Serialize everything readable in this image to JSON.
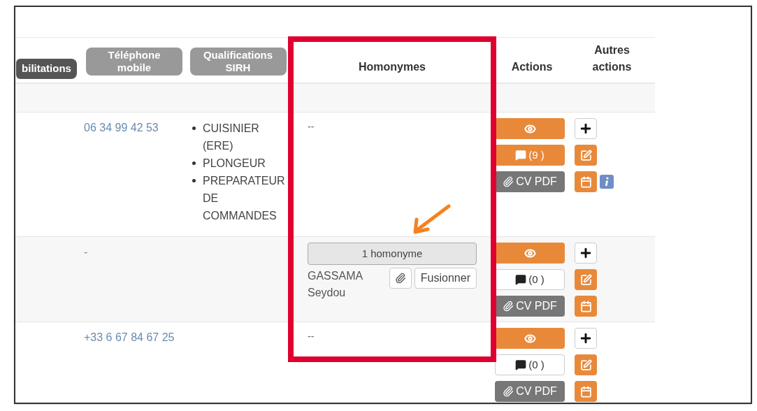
{
  "table": {
    "columns": [
      {
        "label": "bilitations",
        "kind": "pill-dark"
      },
      {
        "label": "Téléphone mobile",
        "kind": "pill"
      },
      {
        "label": "Qualifications SIRH",
        "kind": "pill"
      },
      {
        "label": "Homonymes",
        "kind": "plain"
      },
      {
        "label": "Actions",
        "kind": "plain"
      },
      {
        "label": "Autres actions",
        "kind": "plain"
      }
    ],
    "rows": [
      {
        "phone": "06 34 99 42 53",
        "qualifications": [
          "CUISINIER (ERE)",
          "PLONGEUR",
          "PREPARATEUR DE COMMANDES"
        ],
        "homonymes": {
          "text": "--"
        },
        "comments": {
          "label": "(9 )",
          "highlighted": true
        },
        "cv_label": "CV PDF",
        "info": true
      },
      {
        "phone": "-",
        "qualifications": [],
        "homonymes": {
          "button": "1 homonyme",
          "name": "GASSAMA Seydou",
          "merge": "Fusionner"
        },
        "comments": {
          "label": "(0 )",
          "highlighted": false
        },
        "cv_label": "CV PDF",
        "info": false
      },
      {
        "phone": "+33 6 67 84 67 25",
        "qualifications": [],
        "homonymes": {
          "text": "--"
        },
        "comments": {
          "label": "(0 )",
          "highlighted": false
        },
        "cv_label": "CV PDF",
        "info": false
      }
    ]
  },
  "annotation": {
    "highlight_frame": true,
    "arrow": true
  }
}
